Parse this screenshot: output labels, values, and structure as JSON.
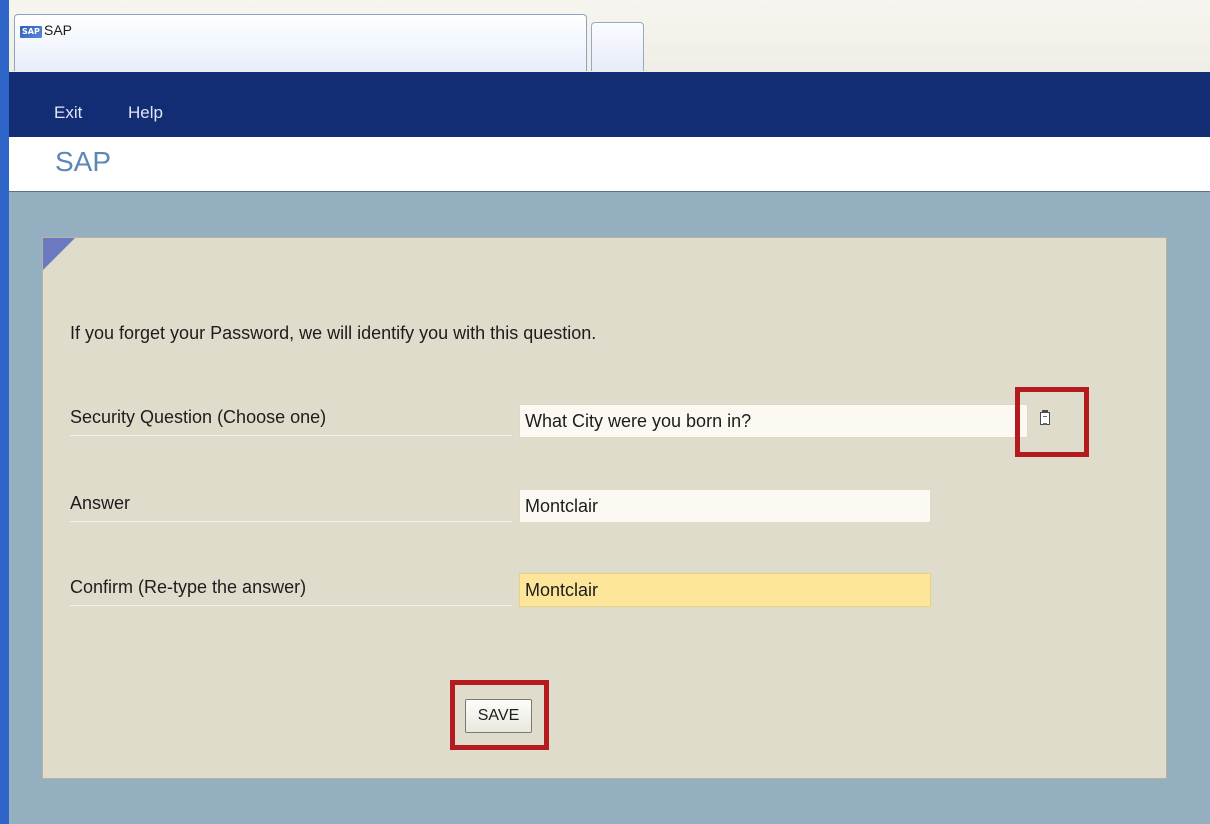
{
  "window": {
    "tab_title": "SAP",
    "logo_text": "SAP"
  },
  "menu": {
    "items": [
      {
        "label": "Exit"
      },
      {
        "label": "Help"
      }
    ]
  },
  "page": {
    "title": "SAP"
  },
  "form": {
    "intro": "If you forget your Password, we will identify you with this question.",
    "security_question": {
      "label": "Security Question (Choose one)",
      "value": "What City were you born in?"
    },
    "answer": {
      "label": "Answer",
      "value": "Montclair"
    },
    "confirm": {
      "label": "Confirm (Re-type the answer)",
      "value": "Montclair"
    },
    "save_label": "SAVE"
  },
  "colors": {
    "menubar": "#122d73",
    "highlight": "#b41b1e",
    "active_field": "#fde69a",
    "panel": "#dfdccb",
    "background": "#94afbf"
  },
  "icons": {
    "dropdown": "clipboard-list-icon"
  }
}
